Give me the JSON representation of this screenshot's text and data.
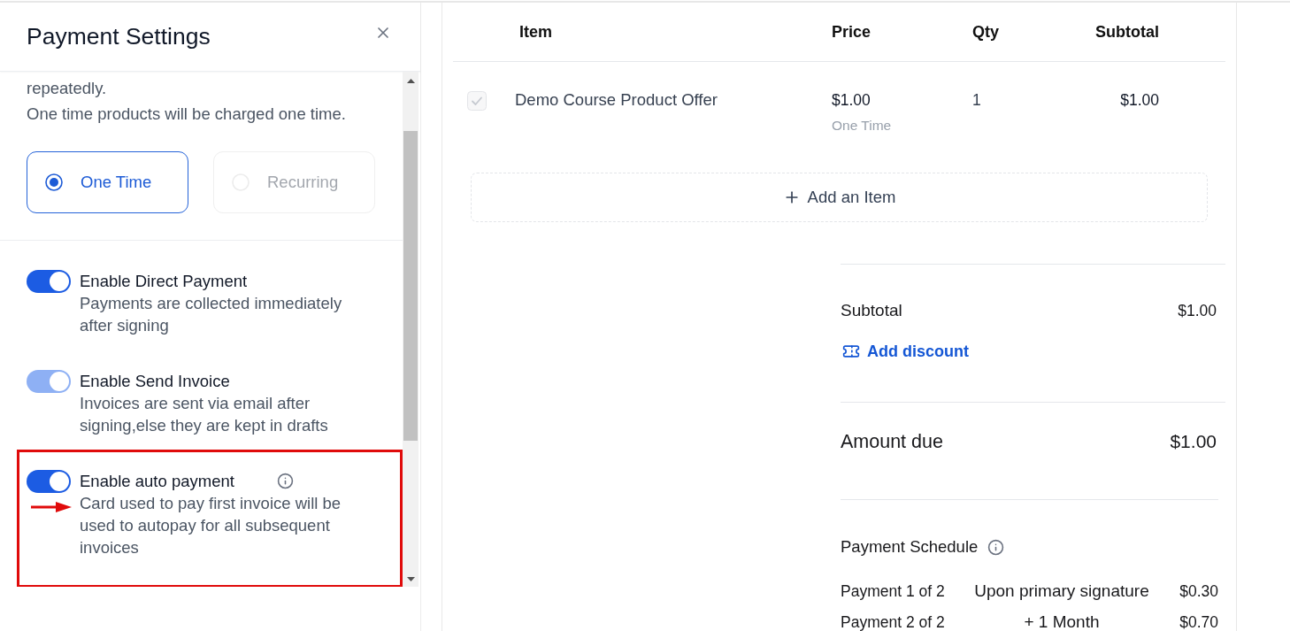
{
  "panel": {
    "title": "Payment Settings",
    "intro": [
      "repeatedly.",
      "One time products will be charged one time."
    ],
    "payment_types": [
      {
        "label": "One Time",
        "selected": true,
        "disabled": false
      },
      {
        "label": "Recurring",
        "selected": false,
        "disabled": true
      }
    ],
    "settings": [
      {
        "title": "Enable Direct Payment",
        "description": "Payments are collected immediately after signing",
        "on": true,
        "disabled": false,
        "info_icon": false,
        "highlighted": false
      },
      {
        "title": "Enable Send Invoice",
        "description": "Invoices are sent via email after signing,else they are kept in drafts",
        "on": true,
        "disabled": true,
        "info_icon": false,
        "highlighted": false
      },
      {
        "title": "Enable auto payment",
        "description": "Card used to pay first invoice will be used to autopay for all subsequent invoices",
        "on": true,
        "disabled": false,
        "info_icon": true,
        "highlighted": true
      }
    ]
  },
  "table": {
    "columns": [
      "Item",
      "Price",
      "Qty",
      "Subtotal"
    ],
    "rows": [
      {
        "checked": true,
        "disabled": true,
        "item": "Demo Course Product Offer",
        "price": "$1.00",
        "billing": "One Time",
        "qty": "1",
        "subtotal": "$1.00"
      }
    ],
    "add_item": "Add an Item"
  },
  "summary": {
    "subtotal": {
      "label": "Subtotal",
      "value": "$1.00"
    },
    "discount_link": "Add discount",
    "amount_due": {
      "label": "Amount due",
      "value": "$1.00"
    },
    "schedule": {
      "title": "Payment Schedule",
      "payments": [
        {
          "label": "Payment 1 of 2",
          "timing": "Upon primary signature",
          "amount": "$0.30"
        },
        {
          "label": "Payment 2 of 2",
          "timing": "+ 1 Month",
          "amount": "$0.70"
        }
      ]
    }
  }
}
